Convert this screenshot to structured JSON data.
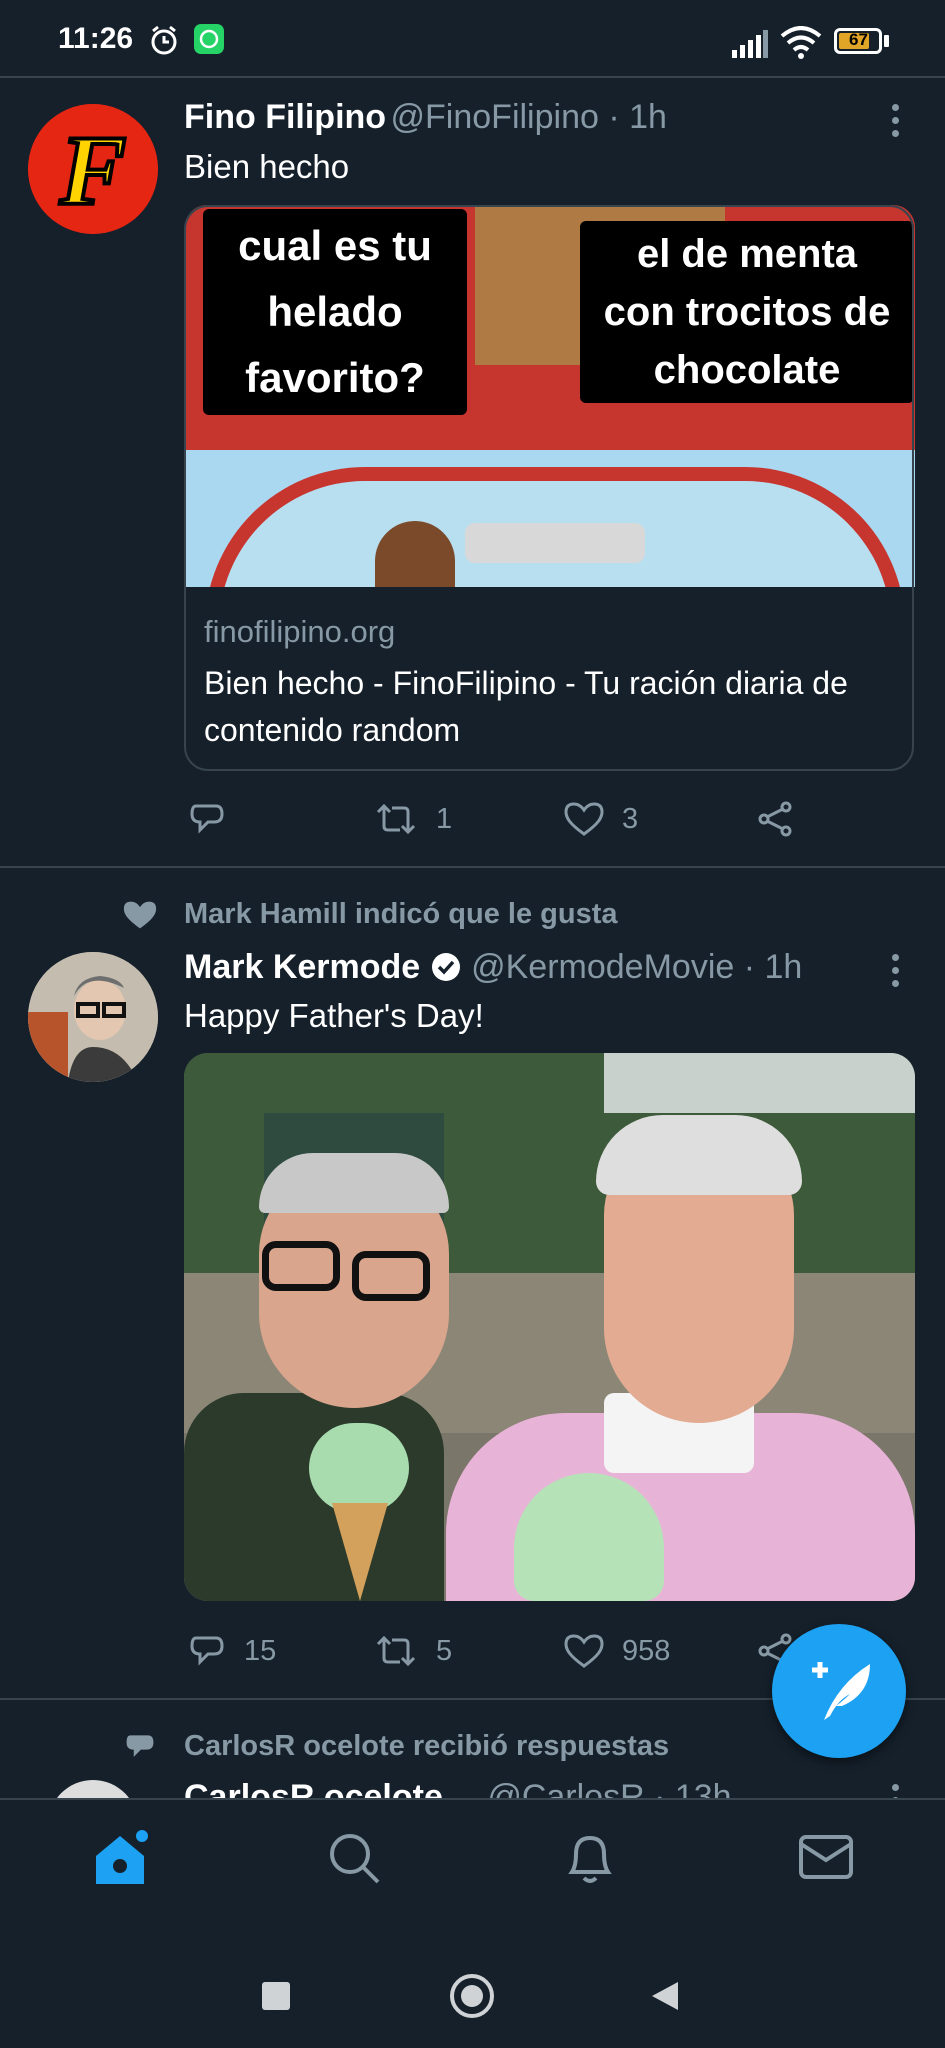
{
  "status_bar": {
    "time": "11:26",
    "battery": "67",
    "icons": [
      "alarm-icon",
      "whatsapp-icon",
      "signal-icon",
      "wifi-icon",
      "battery-icon"
    ]
  },
  "tweets": [
    {
      "name": "Fino Filipino",
      "handle": "@FinoFilipino · 1h",
      "text": "Bien hecho",
      "avatar_letter": "F",
      "meme": {
        "left_bubble": [
          "cual es tu",
          "helado",
          "favorito?"
        ],
        "right_bubble": [
          "el de menta",
          "con trocitos de",
          "chocolate"
        ]
      },
      "card": {
        "domain": "finofilipino.org",
        "title": "Bien hecho - FinoFilipino - Tu ración diaria de contenido random"
      },
      "counts": {
        "replies": "",
        "retweets": "1",
        "likes": "3"
      }
    },
    {
      "context": "Mark Hamill indicó que le gusta",
      "name": "Mark Kermode",
      "handle": "@KermodeMovie · 1h",
      "text": "Happy Father's Day!",
      "counts": {
        "replies": "15",
        "retweets": "5",
        "likes": "958"
      }
    },
    {
      "context": "CarlosR ocelote recibió respuestas",
      "name": "CarlosR ocelote",
      "handle": "@CarlosR · 13h"
    }
  ],
  "colors": {
    "background": "#15202b",
    "accent": "#1da1f2",
    "muted": "#8899a6",
    "divider": "#38444d"
  },
  "bottom_nav": [
    "home-icon",
    "search-icon",
    "notifications-icon",
    "messages-icon"
  ],
  "system_nav": [
    "recents-button",
    "home-button",
    "back-button"
  ]
}
